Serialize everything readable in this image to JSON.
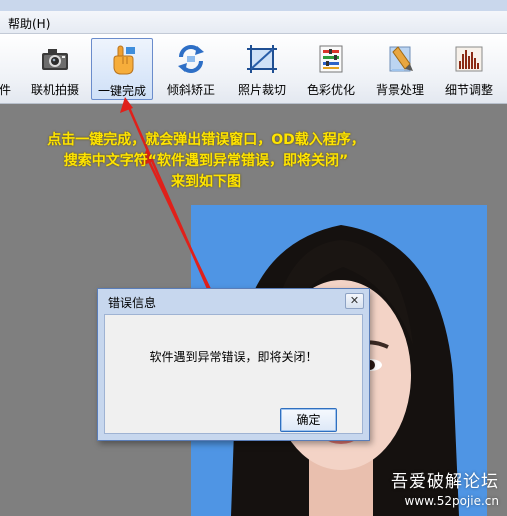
{
  "menu": {
    "help_label": "帮助(H)"
  },
  "toolbar": {
    "items": [
      {
        "label": "件",
        "icon": "file-icon"
      },
      {
        "label": "联机拍摄",
        "icon": "camera-icon"
      },
      {
        "label": "一键完成",
        "icon": "hand-pointer-icon",
        "active": true
      },
      {
        "label": "倾斜矫正",
        "icon": "rotate-arrows-icon"
      },
      {
        "label": "照片裁切",
        "icon": "crop-icon"
      },
      {
        "label": "色彩优化",
        "icon": "color-sliders-icon"
      },
      {
        "label": "背景处理",
        "icon": "paint-brush-icon"
      },
      {
        "label": "细节调整",
        "icon": "histogram-icon"
      }
    ]
  },
  "annotation": {
    "lines": [
      "点击一键完成，就会弹出错误窗口，OD载入程序，",
      "搜索中文字符“软件遇到异常错误，即将关闭”",
      "来到如下图"
    ],
    "color": "#ffe400"
  },
  "dialog": {
    "title": "错误信息",
    "close_label": "✕",
    "message": "软件遇到异常错误，即将关闭！",
    "ok_label": "确定"
  },
  "watermark": {
    "title": "吾爱破解论坛",
    "url": "www.52pojie.cn"
  },
  "colors": {
    "workspace": "#7f7f7f",
    "photo_background": "#4f95e4",
    "arrow": "#e0201a"
  }
}
